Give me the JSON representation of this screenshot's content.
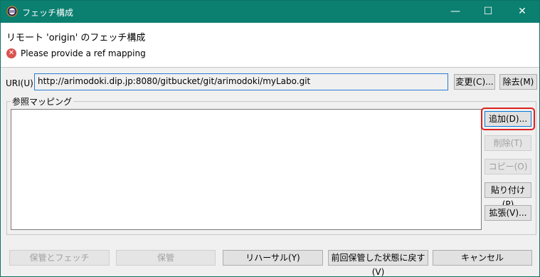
{
  "window": {
    "title": "フェッチ構成",
    "controls": {
      "minimize": "—",
      "maximize": "☐",
      "close": "✕"
    }
  },
  "header": {
    "title": "リモート 'origin' のフェッチ構成",
    "error_icon_glyph": "✕",
    "error_message": "Please provide a ref mapping"
  },
  "uri": {
    "label": "URI(U):",
    "value": "http://arimodoki.dip.jp:8080/gitbucket/git/arimodoki/myLabo.git",
    "change_label": "変更(C)...",
    "remove_label": "除去(M)"
  },
  "ref_mappings": {
    "group_title": "参照マッピング",
    "items": [],
    "buttons": {
      "add": "追加(D)...",
      "delete": "削除(T)",
      "copy": "コピー(O)",
      "paste": "貼り付け(P)",
      "expand": "拡張(V)..."
    }
  },
  "footer": {
    "save_and_fetch": "保管とフェッチ",
    "save": "保管",
    "dry_run": "リハーサル(Y)",
    "revert": "前回保管した状態に戻す(V)",
    "cancel": "キャンセル"
  },
  "colors": {
    "titlebar": "#0b7f70",
    "highlight": "#e02020",
    "error": "#d9534f",
    "focus": "#2b7cd3"
  }
}
